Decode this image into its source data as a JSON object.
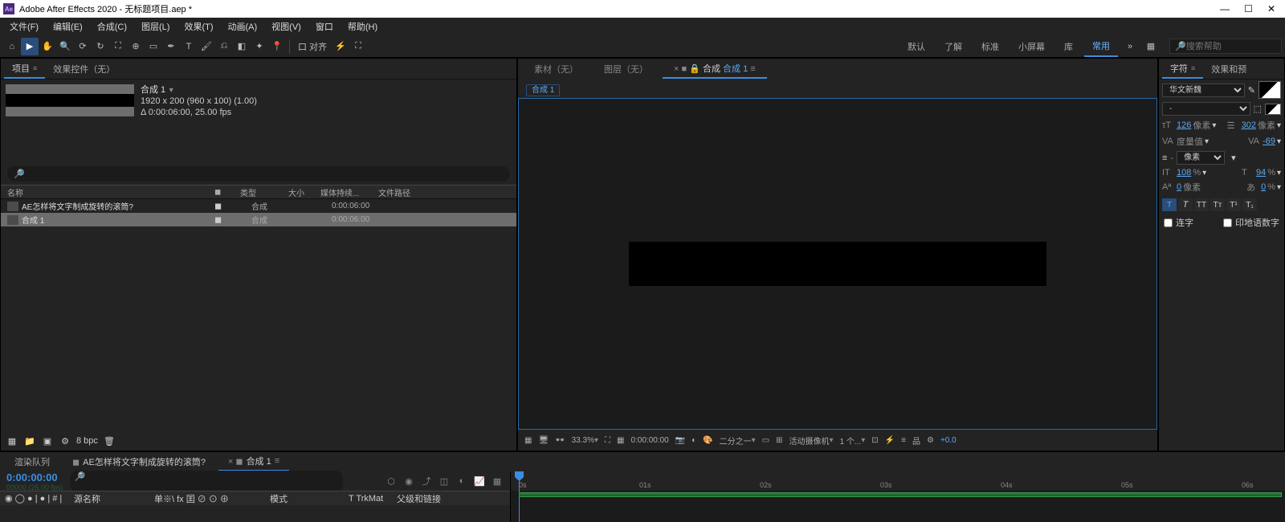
{
  "title": "Adobe After Effects 2020 - 无标题项目.aep *",
  "menu": [
    "文件(F)",
    "编辑(E)",
    "合成(C)",
    "图层(L)",
    "效果(T)",
    "动画(A)",
    "视图(V)",
    "窗口",
    "帮助(H)"
  ],
  "workspace_tabs": [
    "默认",
    "了解",
    "标准",
    "小屏幕",
    "库",
    "常用"
  ],
  "workspace_active": "常用",
  "search_help_placeholder": "搜索帮助",
  "project_panel": {
    "tab_label": "项目",
    "effects_tab": "效果控件（无）",
    "comp_name": "合成 1",
    "comp_dims": "1920 x 200 (960 x 100) (1.00)",
    "comp_dur": "Δ 0:00:06:00, 25.00 fps",
    "columns": [
      "名称",
      "",
      "类型",
      "大小",
      "媒体持续...",
      "文件路径"
    ],
    "rows": [
      {
        "name": "AE怎样将文字制成旋转的滚筒?",
        "type": "合成",
        "dur": "0:00:06:00",
        "sel": false
      },
      {
        "name": "合成 1",
        "type": "合成",
        "dur": "0:00:06:00",
        "sel": true
      }
    ],
    "bpc": "8 bpc"
  },
  "viewer": {
    "tabs": [
      {
        "label": "素材（无）",
        "active": false
      },
      {
        "label": "图层（无）",
        "active": false
      }
    ],
    "comp_tab_prefix": "合成",
    "comp_tab_name": "合成 1",
    "flowchart": "合成 1",
    "zoom": "33.3%",
    "timecode": "0:00:00:00",
    "res": "二分之一",
    "camera": "活动摄像机",
    "views": "1 个...",
    "exposure": "+0.0"
  },
  "char_panel": {
    "tab1": "字符",
    "tab2": "效果和预",
    "font": "华文新魏",
    "style": "-",
    "size": "126",
    "leading": "302",
    "tracking": "-69",
    "unit": "像素",
    "vscale": "108",
    "hscale": "94",
    "baseline": "0",
    "tsume": "0",
    "pct": "%",
    "ligatures": "连字",
    "hindi": "印地语数字"
  },
  "timeline": {
    "tab_render": "渲染队列",
    "tab_other": "AE怎样将文字制成旋转的滚筒?",
    "tab_active": "合成 1",
    "time": "0:00:00:00",
    "fps_hint": "00000 (25.00 fps)",
    "cols": {
      "src": "源名称",
      "switches": "单※\\ fx 囯 ⊘ ⊙ ⊕",
      "mode": "模式",
      "trkmat": "T  TrkMat",
      "parent": "父级和链接"
    },
    "ticks": [
      "0s",
      "01s",
      "02s",
      "03s",
      "04s",
      "05s",
      "06s"
    ]
  }
}
